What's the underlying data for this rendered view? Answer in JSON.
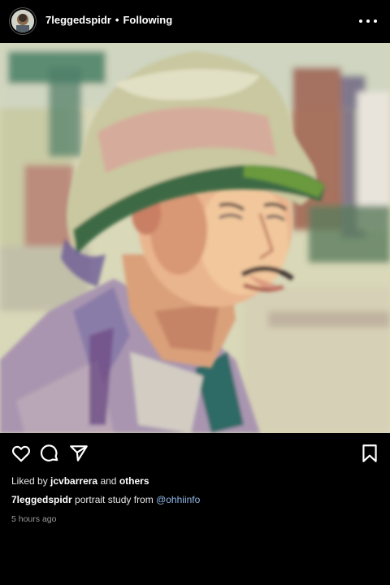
{
  "post": {
    "username": "7leggedspidr",
    "separator": "•",
    "follow_status": "Following",
    "likes": {
      "prefix": "Liked by",
      "user": "jcvbarrera",
      "conjunction": "and",
      "others": "others"
    },
    "caption": {
      "username": "7leggedspidr",
      "text": "portrait study from",
      "mention": "@ohhiinfo"
    },
    "timestamp": "5 hours ago"
  },
  "icons": {
    "more": "more-options-icon",
    "like": "heart-icon",
    "comment": "comment-icon",
    "share": "send-icon",
    "save": "bookmark-icon"
  },
  "colors": {
    "background": "#000000",
    "mention": "#8fb8e8"
  }
}
